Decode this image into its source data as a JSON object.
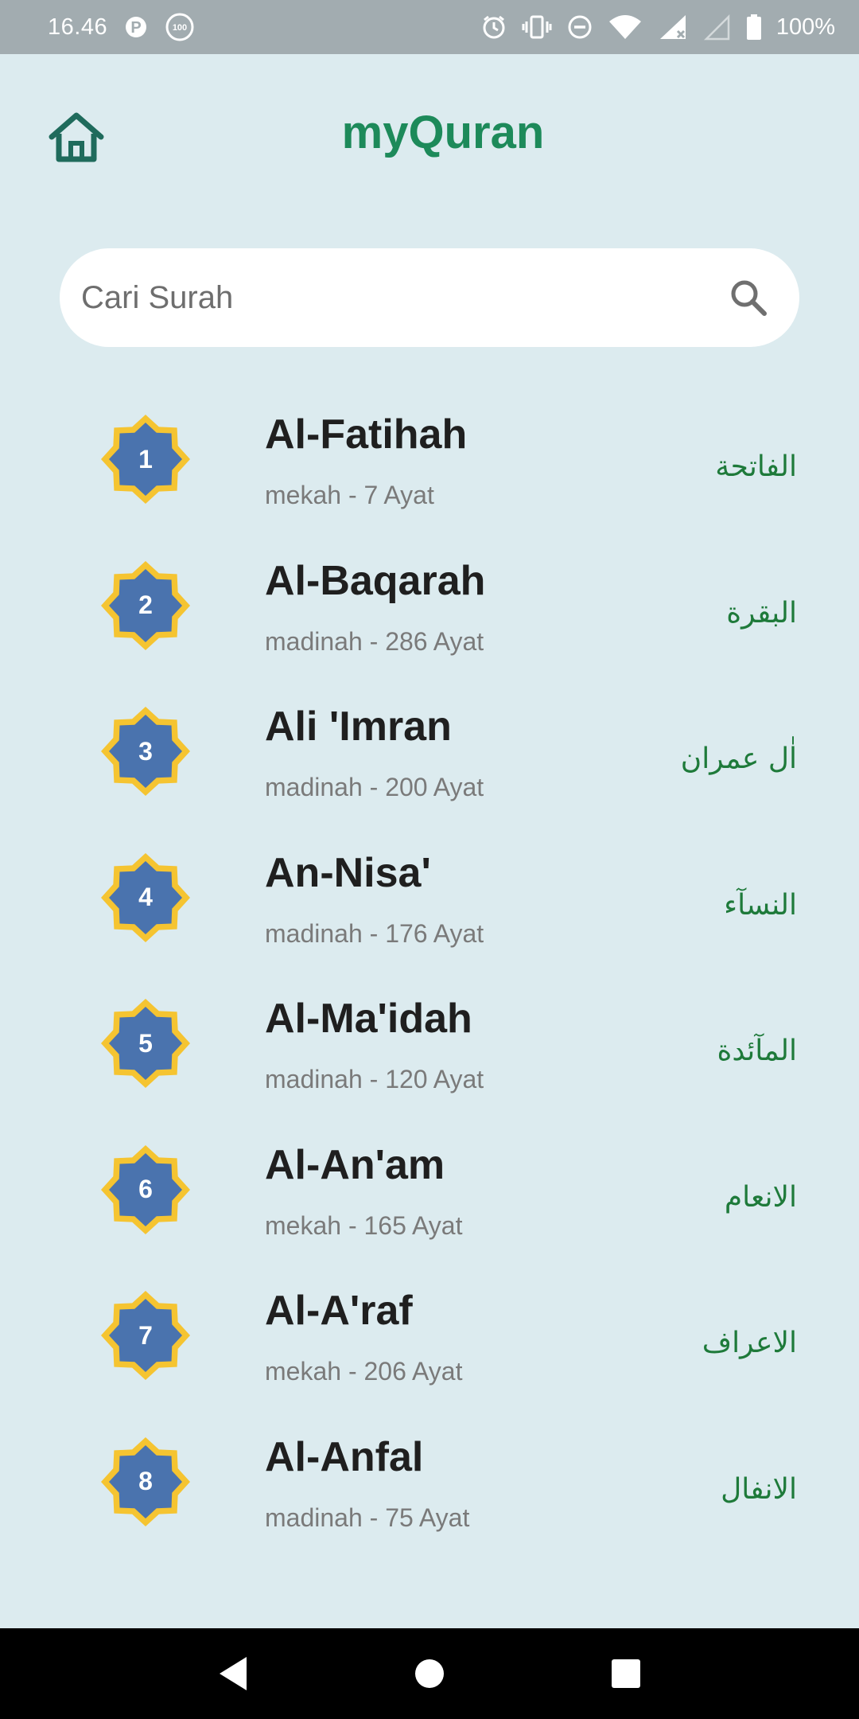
{
  "status_bar": {
    "time": "16.46",
    "battery": "100%",
    "icons": [
      "parking-icon",
      "badge-100-icon",
      "alarm-icon",
      "vibrate-icon",
      "dnd-icon",
      "wifi-icon",
      "signal-icon",
      "signal-empty-icon",
      "battery-icon"
    ],
    "badge_text": "100"
  },
  "header": {
    "title": "myQuran",
    "home_icon": "home-icon",
    "title_color": "#1d8a5a"
  },
  "search": {
    "placeholder": "Cari Surah",
    "icon": "search-icon"
  },
  "surahs": [
    {
      "number": "1",
      "name": "Al-Fatihah",
      "meta": "mekah - 7 Ayat",
      "arabic": "الفاتحة"
    },
    {
      "number": "2",
      "name": "Al-Baqarah",
      "meta": "madinah - 286 Ayat",
      "arabic": "البقرة"
    },
    {
      "number": "3",
      "name": "Ali 'Imran",
      "meta": "madinah - 200 Ayat",
      "arabic": "اٰل عمران"
    },
    {
      "number": "4",
      "name": "An-Nisa'",
      "meta": "madinah - 176 Ayat",
      "arabic": "النسآء"
    },
    {
      "number": "5",
      "name": "Al-Ma'idah",
      "meta": "madinah - 120 Ayat",
      "arabic": "المآئدة"
    },
    {
      "number": "6",
      "name": "Al-An'am",
      "meta": "mekah - 165 Ayat",
      "arabic": "الانعام"
    },
    {
      "number": "7",
      "name": "Al-A'raf",
      "meta": "mekah - 206 Ayat",
      "arabic": "الاعراف"
    },
    {
      "number": "8",
      "name": "Al-Anfal",
      "meta": "madinah - 75 Ayat",
      "arabic": "الانفال"
    }
  ],
  "colors": {
    "background": "#dcebef",
    "badge_fill": "#4a73ae",
    "badge_border": "#f5c431",
    "arabic_text": "#1e7a3a"
  },
  "nav_bar": {
    "icons": [
      "back-icon",
      "home-circle-icon",
      "recents-icon"
    ]
  }
}
